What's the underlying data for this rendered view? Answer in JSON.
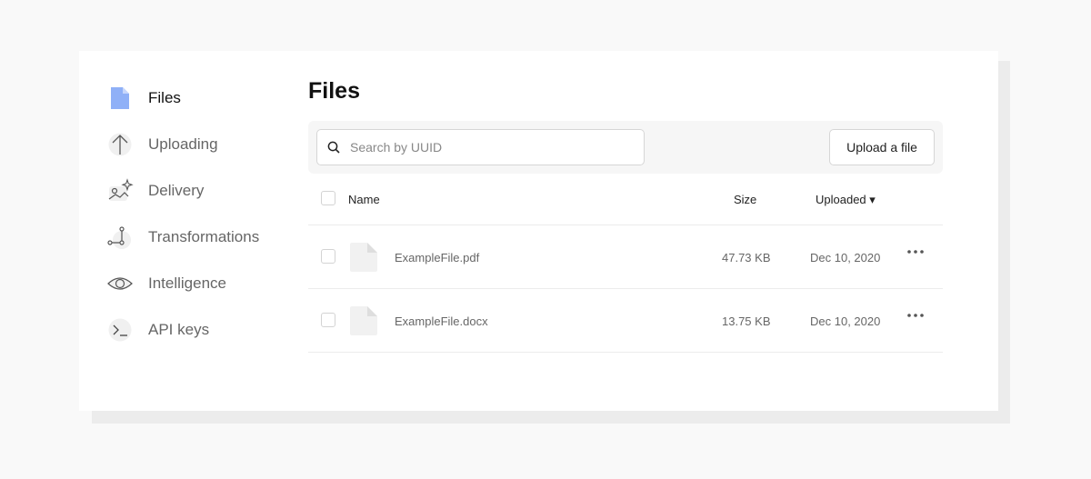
{
  "sidebar": {
    "items": [
      {
        "label": "Files",
        "icon": "file-icon",
        "active": true
      },
      {
        "label": "Uploading",
        "icon": "arrow-up-icon"
      },
      {
        "label": "Delivery",
        "icon": "image-sparkle-icon"
      },
      {
        "label": "Transformations",
        "icon": "vector-nodes-icon"
      },
      {
        "label": "Intelligence",
        "icon": "eye-icon"
      },
      {
        "label": "API keys",
        "icon": "terminal-icon"
      }
    ]
  },
  "main": {
    "title": "Files",
    "search": {
      "placeholder": "Search by UUID",
      "value": ""
    },
    "upload_label": "Upload a file",
    "table": {
      "headers": {
        "name": "Name",
        "size": "Size",
        "uploaded": "Uploaded ▾"
      },
      "rows": [
        {
          "name": "ExampleFile.pdf",
          "size": "47.73 KB",
          "uploaded": "Dec 10, 2020"
        },
        {
          "name": "ExampleFile.docx",
          "size": "13.75 KB",
          "uploaded": "Dec 10, 2020"
        }
      ]
    }
  },
  "colors": {
    "accent_file_icon": "#8fb0f7",
    "text_muted": "#666666",
    "toolbar_bg": "#f6f6f6"
  }
}
